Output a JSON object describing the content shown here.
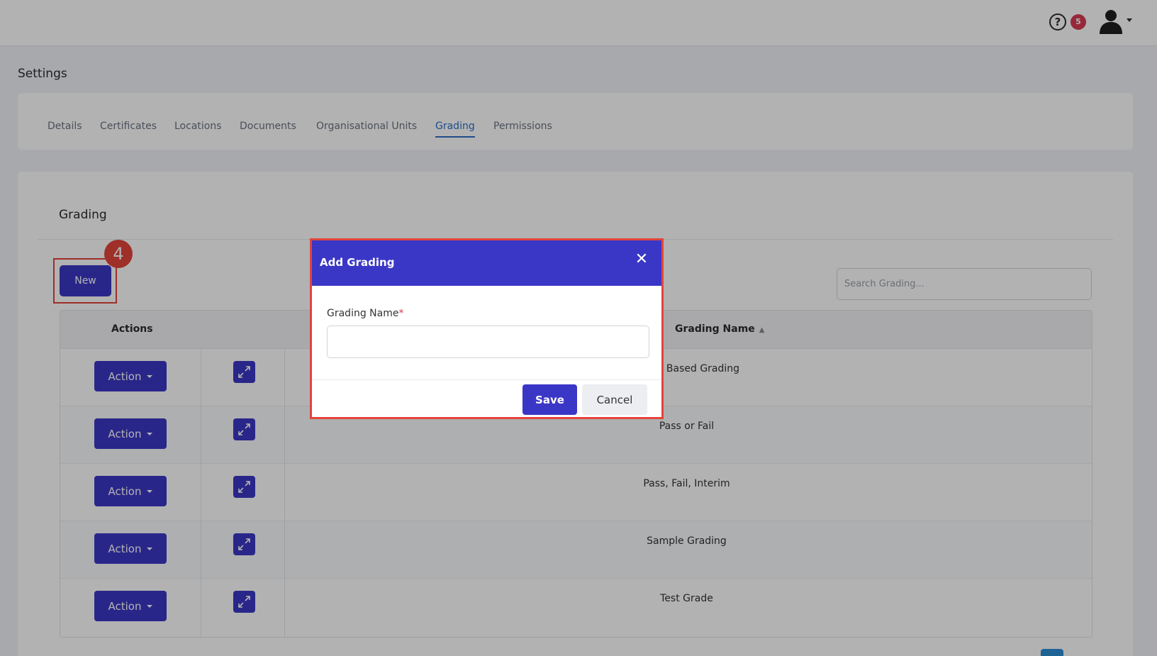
{
  "header": {
    "help_icon": "help-circle-icon",
    "notification_count": "5",
    "avatar_icon": "user-avatar-icon"
  },
  "page": {
    "title": "Settings"
  },
  "tabs": [
    {
      "label": "Details"
    },
    {
      "label": "Certificates"
    },
    {
      "label": "Locations"
    },
    {
      "label": "Documents"
    },
    {
      "label": "Organisational Units"
    },
    {
      "label": "Grading",
      "active": true
    },
    {
      "label": "Permissions"
    }
  ],
  "grading": {
    "title": "Grading",
    "new_label": "New",
    "step_number": "4",
    "search_placeholder": "Search Grading...",
    "columns": {
      "actions": "Actions",
      "name": "Grading Name"
    },
    "action_label": "Action",
    "rows": [
      {
        "name": "Letter Based Grading"
      },
      {
        "name": "Pass or Fail"
      },
      {
        "name": "Pass, Fail, Interim"
      },
      {
        "name": "Sample Grading"
      },
      {
        "name": "Test Grade"
      }
    ]
  },
  "modal": {
    "title": "Add Grading",
    "field_label": "Grading Name",
    "required_mark": "*",
    "field_value": "",
    "save_label": "Save",
    "cancel_label": "Cancel"
  },
  "colors": {
    "primary": "#3b37c6",
    "highlight": "#e3443c",
    "active_tab": "#2d6fc7",
    "badge": "#d83a52"
  }
}
